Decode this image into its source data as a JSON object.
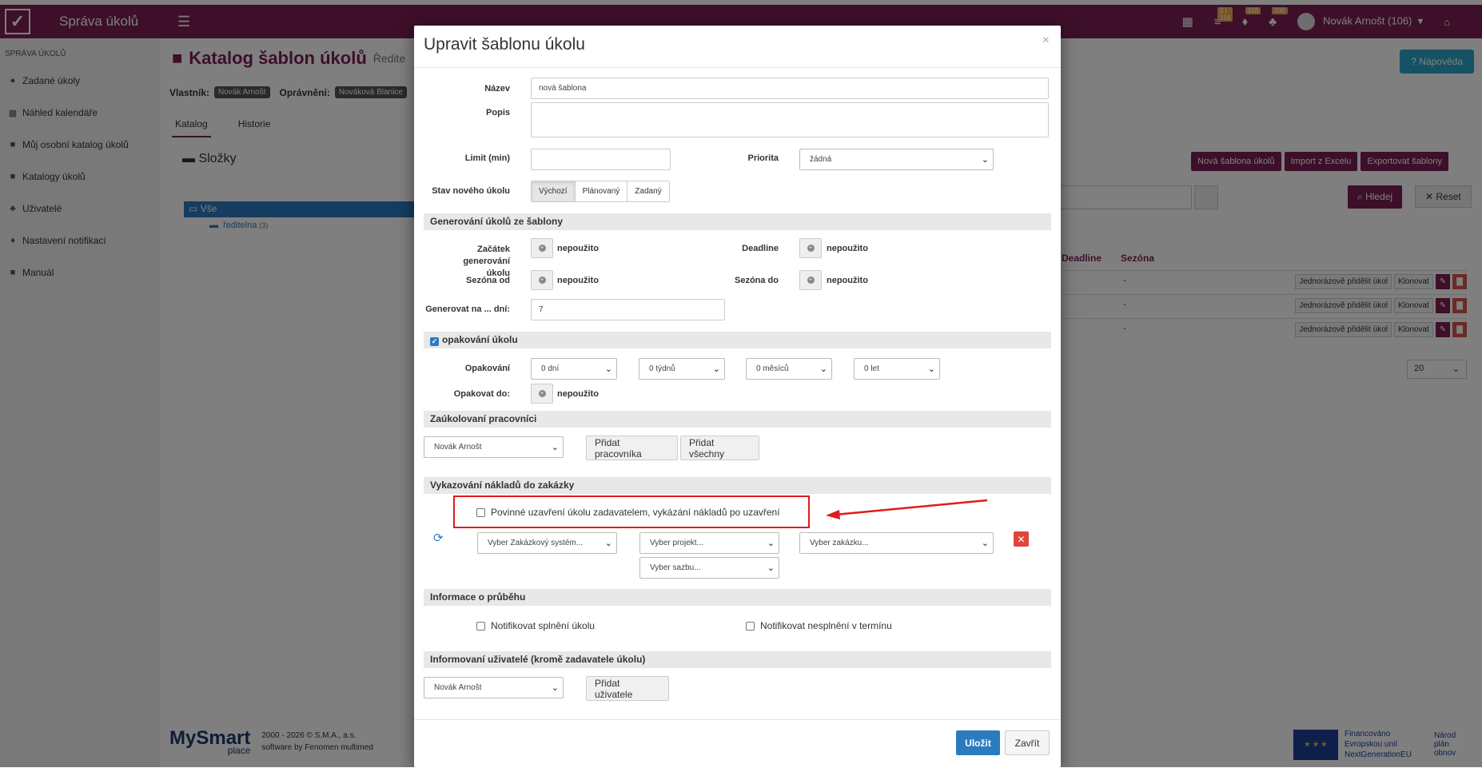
{
  "app": {
    "title": "Správa úkolů",
    "user": "Novák Arnošt (106)",
    "notify_badges": [
      "2 | 318",
      "318",
      "330"
    ]
  },
  "sidebar": {
    "heading": "SPRÁVA ÚKOLŮ",
    "items": [
      {
        "label": "Zadané úkoly",
        "icon": "check-circle-icon"
      },
      {
        "label": "Náhled kalendáře",
        "icon": "calendar-icon"
      },
      {
        "label": "Můj osobní katalog úkolů",
        "icon": "book-icon"
      },
      {
        "label": "Katalogy úkolů",
        "icon": "book-icon"
      },
      {
        "label": "Uživatelé",
        "icon": "users-icon"
      },
      {
        "label": "Nastavení notifikací",
        "icon": "bell-icon"
      },
      {
        "label": "Manuál",
        "icon": "book-icon"
      }
    ]
  },
  "page": {
    "title": "Katalog šablon úkolů",
    "subtitle": "Ředite",
    "owner_label": "Vlastník:",
    "owner": "Novák Arnošt",
    "permission_label": "Oprávnění:",
    "permission": "Nováková Blanice",
    "help": "Nápověda",
    "tabs": [
      "Katalog",
      "Historie"
    ],
    "folders_title": "Složky",
    "tree_all": "Vše",
    "tree_sub": "ředitelna",
    "tree_sub_count": "(3)",
    "actions": [
      "Nová šablona úkolů",
      "Import z Excelu",
      "Exportovat šablony"
    ],
    "search_btn": "Hledej",
    "reset_btn": "Reset",
    "columns": [
      "Deadline",
      "Sezóna"
    ],
    "row_dash": "-",
    "row_buttons": [
      "Jednorázově přidělit úkol",
      "Klonovat"
    ],
    "pager_size": "20"
  },
  "footer": {
    "logo_main": "MySmart",
    "logo_sub": "place",
    "copyright": "2000 - 2026 © S.M.A., a.s.",
    "software": "software by Fenomen multimed",
    "eu_line1": "Financováno",
    "eu_line2": "Evropskou unií",
    "eu_line3": "NextGenerationEU",
    "npo_line1": "Národ",
    "npo_line2": "plán",
    "npo_line3": "obnov"
  },
  "modal": {
    "title": "Upravit šablonu úkolu",
    "fields": {
      "name_label": "Název",
      "name_value": "nová šablona",
      "desc_label": "Popis",
      "desc_value": "",
      "limit_label": "Limit (min)",
      "limit_value": "",
      "priority_label": "Priorita",
      "priority_value": "žádná",
      "state_label": "Stav nového úkolu",
      "state_options": [
        "Výchozí",
        "Plánovaný",
        "Zadaný"
      ],
      "state_selected": "Výchozí"
    },
    "generation": {
      "section": "Generování úkolů ze šablony",
      "start_label_1": "Začátek generování",
      "start_label_2": "úkolu",
      "start_value": "nepoužito",
      "deadline_label": "Deadline",
      "deadline_value": "nepoužito",
      "season_from_label": "Sezóna od",
      "season_from_value": "nepoužito",
      "season_to_label": "Sezóna do",
      "season_to_value": "nepoužito",
      "generate_days_label": "Generovat na ... dní:",
      "generate_days_value": "7"
    },
    "repeat": {
      "section": "opakování úkolu",
      "repeat_label": "Opakování",
      "days": "0 dní",
      "weeks": "0 týdnů",
      "months": "0 měsíců",
      "years": "0 let",
      "repeat_until_label": "Opakovat do:",
      "repeat_until_value": "nepoužito"
    },
    "workers": {
      "section": "Zaúkolovaní pracovníci",
      "selected": "Novák Arnošt",
      "add_worker": "Přidat pracovníka",
      "add_all": "Přidat všechny"
    },
    "costs": {
      "section": "Vykazování nákladů do zakázky",
      "mandatory_close": "Povinné uzavření úkolu zadavatelem, vykázání nákladů po uzavření",
      "system_placeholder": "Vyber Zakázkový systém...",
      "project_placeholder": "Vyber projekt...",
      "order_placeholder": "Vyber zakázku...",
      "rate_placeholder": "Vyber sazbu..."
    },
    "progress": {
      "section": "Informace o průběhu",
      "notify_done": "Notifikovat splnění úkolu",
      "notify_missed": "Notifikovat nesplnění v termínu"
    },
    "informed": {
      "section": "Informovaní uživatelé (kromě zadavatele úkolu)",
      "selected": "Novák Arnošt",
      "add_user": "Přidat uživatele"
    },
    "save": "Uložit",
    "close": "Zavřít"
  },
  "colors": {
    "brand": "#7a1f52",
    "primary": "#2a7bbf",
    "annotation": "#e01b1b"
  }
}
